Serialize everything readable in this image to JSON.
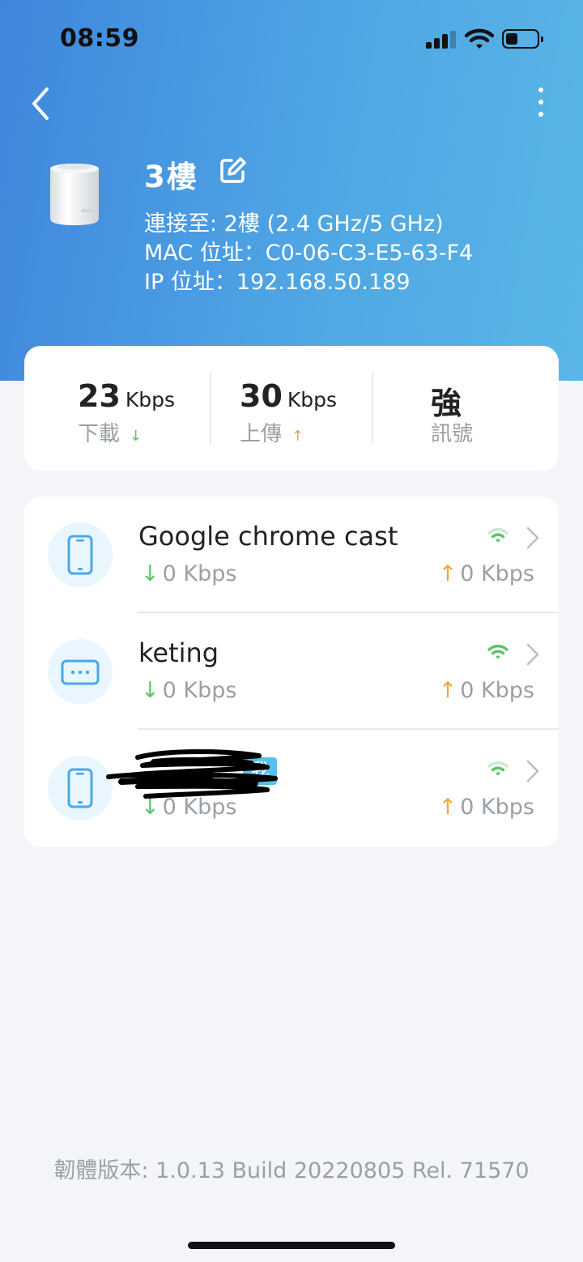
{
  "status_bar": {
    "time": "08:59",
    "battery_level": 0.4
  },
  "header": {
    "device_name": "3樓",
    "connected_to": "連接至: 2樓 (2.4 GHz/5 GHz)",
    "mac": "MAC 位址：C0-06-C3-E5-63-F4",
    "ip": "IP 位址：192.168.50.189",
    "icons": {
      "back": "chevron-left-icon",
      "more": "more-vertical-icon",
      "edit": "edit-icon"
    }
  },
  "stats": {
    "download": {
      "value": "23",
      "unit": "Kbps",
      "label": "下載"
    },
    "upload": {
      "value": "30",
      "unit": "Kbps",
      "label": "上傳"
    },
    "signal": {
      "value": "強",
      "label": "訊號"
    }
  },
  "clients": [
    {
      "name": "Google chrome cast",
      "icon": "phone-icon",
      "down": "0 Kbps",
      "up": "0 Kbps",
      "wifi_strength": "weak"
    },
    {
      "name": "keting",
      "icon": "router-device-icon",
      "down": "0 Kbps",
      "up": "0 Kbps",
      "wifi_strength": "strong"
    },
    {
      "name": "",
      "icon": "phone-icon",
      "badge": "我",
      "down": "0 Kbps",
      "up": "0 Kbps",
      "wifi_strength": "weak"
    }
  ],
  "arrows": {
    "down": "↓",
    "up": "↑"
  },
  "firmware": "韌體版本: 1.0.13 Build 20220805 Rel. 71570",
  "colors": {
    "accent": "#4a9be3",
    "down_arrow": "#5ec46a",
    "up_arrow": "#f0a63a",
    "wifi": "#5ec46a"
  }
}
